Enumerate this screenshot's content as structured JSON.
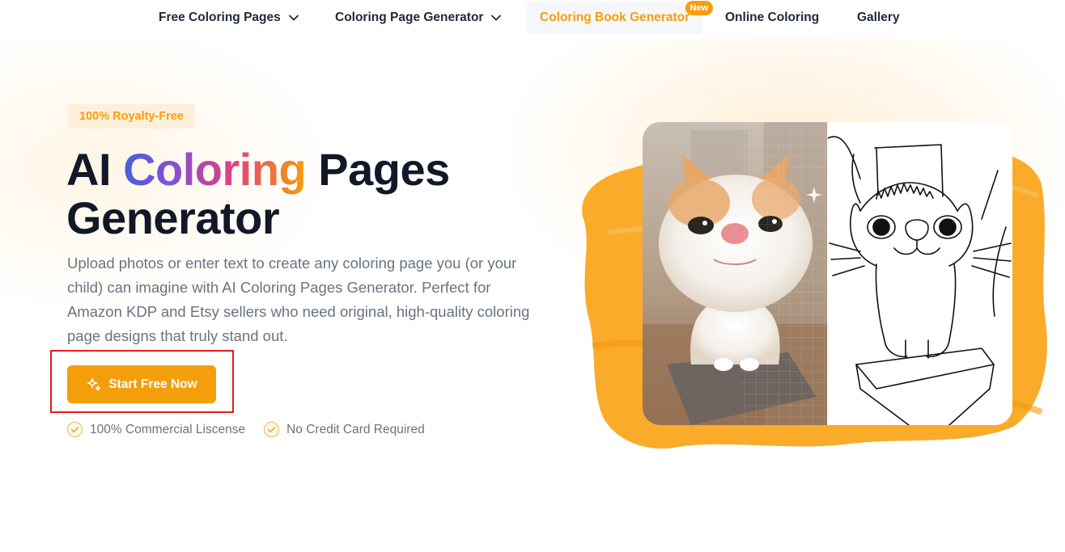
{
  "nav": {
    "items": [
      {
        "label": "Free Coloring Pages",
        "has_dropdown": true
      },
      {
        "label": "Coloring Page Generator",
        "has_dropdown": true
      },
      {
        "label": "Coloring Book Generator",
        "badge": "New",
        "active": true
      },
      {
        "label": "Online Coloring"
      },
      {
        "label": "Gallery"
      }
    ]
  },
  "hero": {
    "badge": "100% Royalty-Free",
    "title_part1": "AI ",
    "title_highlight": "Coloring",
    "title_part2": " Pages",
    "title_line2": "Generator",
    "description": "Upload photos or enter text to create any coloring page you (or your child) can imagine with AI Coloring Pages Generator. Perfect for Amazon KDP and Etsy sellers who need original, high-quality coloring page designs that truly stand out.",
    "cta_label": "Start Free Now",
    "perks": [
      "100% Commercial Liscense",
      "No Credit Card Required"
    ]
  },
  "colors": {
    "accent": "#f59e0b",
    "badge_bg": "#fdf0db",
    "highlight_frame": "#e11d1d",
    "text_dark": "#111827",
    "text_muted": "#6b7280"
  },
  "icons": {
    "cta": "sparkles-icon",
    "perk": "check-circle-icon",
    "dropdown": "chevron-down-icon"
  }
}
